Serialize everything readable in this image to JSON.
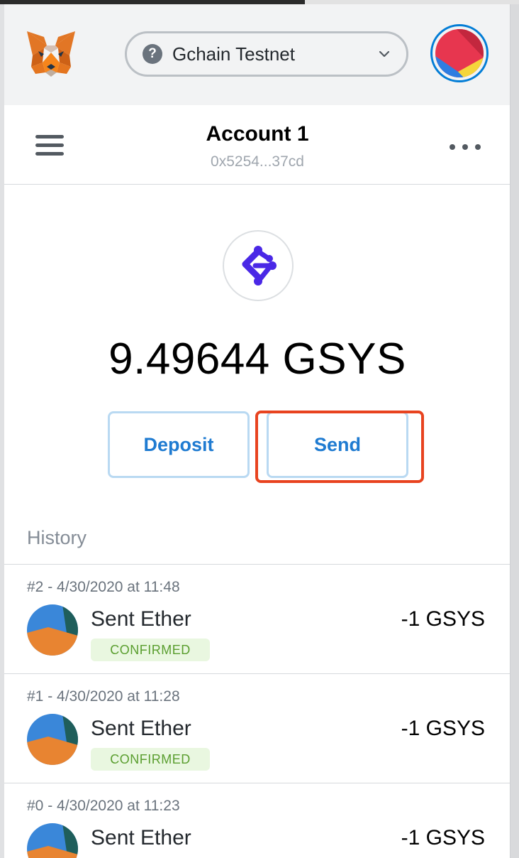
{
  "network": {
    "name": "Gchain Testnet",
    "icon": "question-icon"
  },
  "account": {
    "name": "Account 1",
    "address": "0x5254...37cd"
  },
  "balance": {
    "amount": "9.49644 GSYS"
  },
  "actions": {
    "deposit_label": "Deposit",
    "send_label": "Send"
  },
  "history": {
    "label": "History",
    "items": [
      {
        "date": "#2 - 4/30/2020 at 11:48",
        "title": "Sent Ether",
        "status": "CONFIRMED",
        "amount": "-1 GSYS"
      },
      {
        "date": "#1 - 4/30/2020 at 11:28",
        "title": "Sent Ether",
        "status": "CONFIRMED",
        "amount": "-1 GSYS"
      },
      {
        "date": "#0 - 4/30/2020 at 11:23",
        "title": "Sent Ether",
        "status": "",
        "amount": "-1 GSYS"
      }
    ]
  },
  "colors": {
    "accent": "#037dd6",
    "button_text": "#1f7bd1",
    "highlight": "#e8431f",
    "confirmed": "#5a9e2f"
  }
}
